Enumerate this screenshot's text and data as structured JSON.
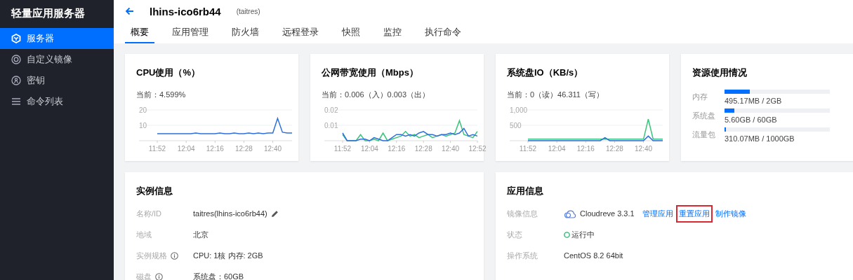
{
  "sidebar": {
    "title": "轻量应用服务器",
    "items": [
      {
        "label": "服务器",
        "selected": true
      },
      {
        "label": "自定义镜像",
        "selected": false
      },
      {
        "label": "密钥",
        "selected": false
      },
      {
        "label": "命令列表",
        "selected": false
      }
    ]
  },
  "header": {
    "title": "lhins-ico6rb44",
    "subtitle": "(taitres)",
    "tabs": [
      {
        "label": "概要",
        "selected": true
      },
      {
        "label": "应用管理",
        "selected": false
      },
      {
        "label": "防火墙",
        "selected": false
      },
      {
        "label": "远程登录",
        "selected": false
      },
      {
        "label": "快照",
        "selected": false
      },
      {
        "label": "监控",
        "selected": false
      },
      {
        "label": "执行命令",
        "selected": false
      }
    ]
  },
  "metrics": [
    {
      "title": "CPU使用（%）",
      "current": "当前：4.599%",
      "chart_data": {
        "type": "line",
        "categories": [
          "11:52",
          null,
          null,
          null,
          null,
          null,
          "12:04",
          null,
          null,
          null,
          null,
          null,
          "12:16",
          null,
          null,
          null,
          null,
          null,
          "12:28",
          null,
          null,
          null,
          null,
          null,
          "12:40",
          null,
          null,
          null,
          null
        ],
        "ylim": [
          0,
          20
        ],
        "yticks": [
          10,
          20
        ],
        "series": [
          {
            "color": "#2f6fdb",
            "values": [
              4.5,
              4.5,
              4.5,
              4.5,
              4.5,
              4.5,
              4.5,
              4.5,
              5,
              4.5,
              4.5,
              4.5,
              4.5,
              5,
              4.5,
              4.5,
              5,
              4.5,
              4.5,
              5,
              4.5,
              5,
              4.5,
              5,
              5,
              14.5,
              5.5,
              5,
              5
            ]
          }
        ]
      }
    },
    {
      "title": "公网带宽使用（Mbps）",
      "current": "当前：0.006（入）0.003（出）",
      "chart_data": {
        "type": "line",
        "categories": [
          "11:52",
          null,
          null,
          null,
          null,
          null,
          "12:04",
          null,
          null,
          null,
          null,
          null,
          "12:16",
          null,
          null,
          null,
          null,
          null,
          "12:28",
          null,
          null,
          null,
          null,
          null,
          "12:40",
          null,
          null,
          null,
          null,
          null,
          "12:52"
        ],
        "ylim": [
          0,
          0.02
        ],
        "yticks": [
          0.01,
          0.02
        ],
        "series": [
          {
            "color": "#3cc47c",
            "values": [
              0.004,
              0,
              0,
              0,
              0.004,
              0,
              0,
              0.001,
              0,
              0.005,
              0,
              0.001,
              0.002,
              0.003,
              0.006,
              0.003,
              0.004,
              0.002,
              0.003,
              0.004,
              0.002,
              0.003,
              0.004,
              0.003,
              0.004,
              0.005,
              0.013,
              0.004,
              0.003,
              0.002,
              0.006
            ]
          },
          {
            "color": "#2f6fdb",
            "values": [
              0.005,
              0,
              0,
              0,
              0.001,
              0.001,
              0,
              0.002,
              0.001,
              0,
              0,
              0.002,
              0.004,
              0.004,
              0.003,
              0.004,
              0.003,
              0.005,
              0.006,
              0.004,
              0.004,
              0.003,
              0.004,
              0.004,
              0.005,
              0.004,
              0.005,
              0.008,
              0.003,
              0.004,
              0.003
            ]
          }
        ]
      }
    },
    {
      "title": "系统盘IO（KB/s）",
      "current": "当前：0（读）46.311（写）",
      "chart_data": {
        "type": "line",
        "categories": [
          "11:52",
          null,
          null,
          null,
          null,
          null,
          "12:04",
          null,
          null,
          null,
          null,
          null,
          "12:16",
          null,
          null,
          null,
          null,
          null,
          "12:28",
          null,
          null,
          null,
          null,
          null,
          "12:40",
          null,
          null,
          null,
          null
        ],
        "ylim": [
          0,
          1000
        ],
        "yticks": [
          500,
          {
            "value": 1000,
            "label": "1,000"
          }
        ],
        "series": [
          {
            "color": "#3cc47c",
            "values": [
              50,
              50,
              50,
              50,
              50,
              50,
              50,
              50,
              50,
              50,
              50,
              50,
              50,
              50,
              50,
              50,
              50,
              50,
              50,
              50,
              50,
              50,
              50,
              50,
              50,
              700,
              50,
              50,
              50
            ]
          },
          {
            "color": "#2f6fdb",
            "values": [
              0,
              0,
              0,
              0,
              0,
              0,
              0,
              0,
              0,
              0,
              0,
              0,
              0,
              0,
              0,
              0,
              100,
              0,
              0,
              0,
              0,
              0,
              0,
              0,
              0,
              150,
              0,
              0,
              0
            ]
          }
        ]
      }
    }
  ],
  "resources": {
    "title": "资源使用情况",
    "items": [
      {
        "label": "内存",
        "value": "495.17MB / 2GB",
        "level": 0.24
      },
      {
        "label": "系统盘",
        "value": "5.60GB / 60GB",
        "level": 0.09
      },
      {
        "label": "流量包",
        "value": "310.07MB / 1000GB",
        "level": 0.01
      }
    ]
  },
  "instance": {
    "title": "实例信息",
    "rows": [
      {
        "label": "名称/ID",
        "value": "taitres(lhins-ico6rb44)",
        "info": false,
        "editable": true
      },
      {
        "label": "地域",
        "value": "北京",
        "info": false,
        "editable": false
      },
      {
        "label": "实例规格",
        "value": "CPU: 1核 内存: 2GB",
        "info": true,
        "editable": false
      },
      {
        "label": "磁盘",
        "value": "系统盘：60GB",
        "info": true,
        "editable": false
      }
    ]
  },
  "app": {
    "title": "应用信息",
    "rows": [
      {
        "kind": "image",
        "label": "镜像信息",
        "value": "Cloudreve 3.3.1",
        "links": [
          {
            "label": "管理应用",
            "highlighted": false
          },
          {
            "label": "重置应用",
            "highlighted": true
          },
          {
            "label": "制作镜像",
            "highlighted": false
          }
        ]
      },
      {
        "kind": "status",
        "label": "状态",
        "value": "运行中"
      },
      {
        "kind": "text",
        "label": "操作系统",
        "value": "CentOS 8.2 64bit"
      }
    ]
  }
}
